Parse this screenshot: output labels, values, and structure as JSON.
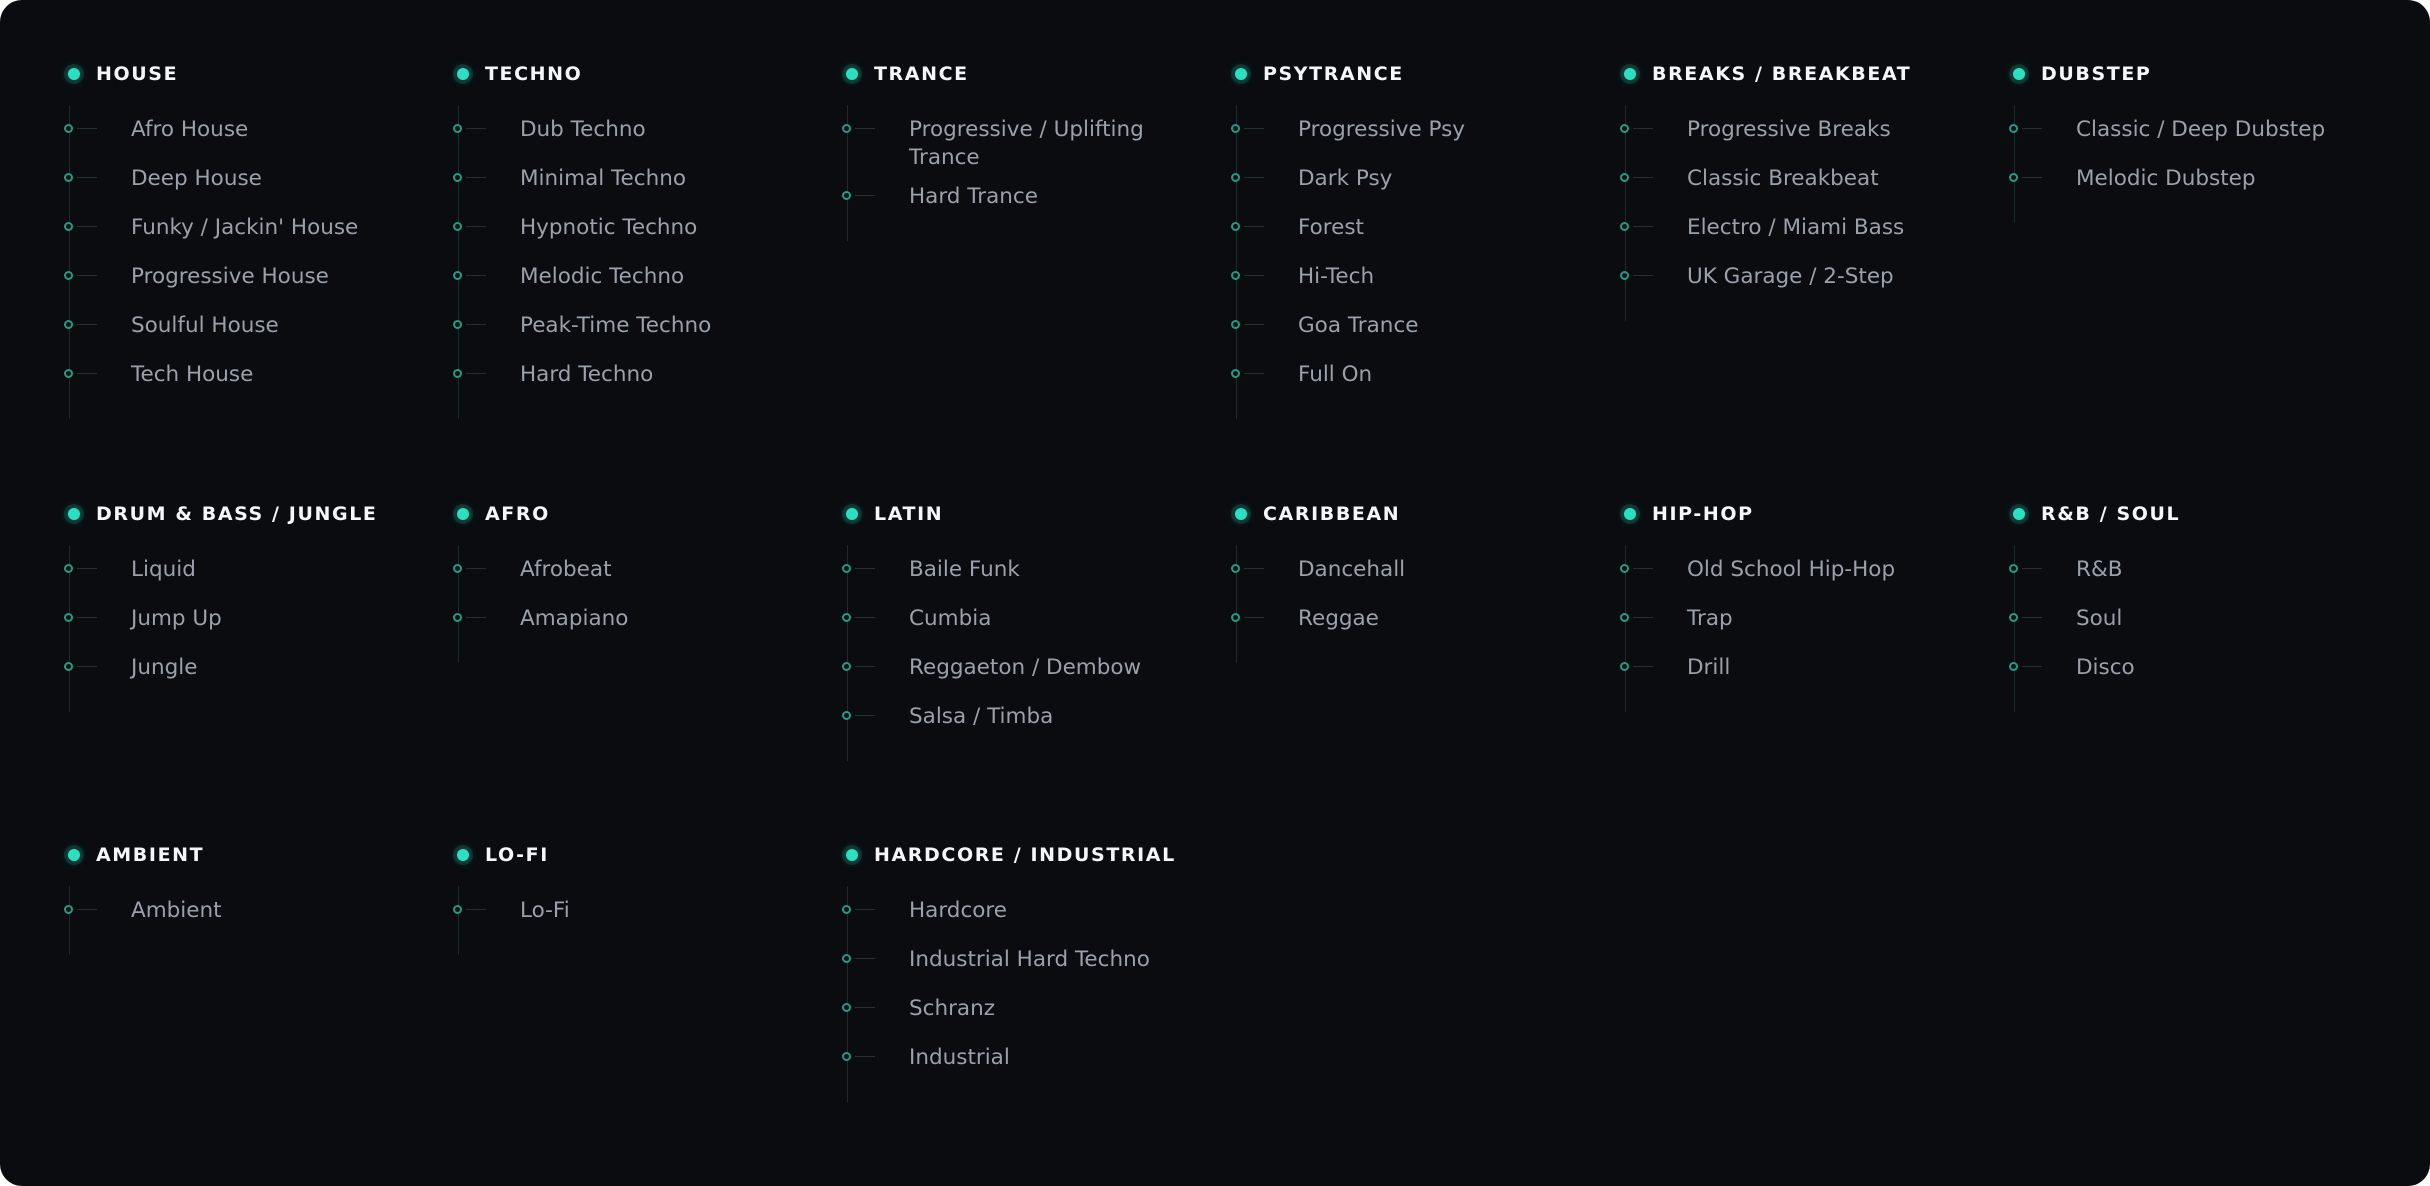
{
  "groups": [
    {
      "title": "HOUSE",
      "items": [
        "Afro House",
        "Deep House",
        "Funky / Jackin' House",
        "Progressive House",
        "Soulful House",
        "Tech House"
      ]
    },
    {
      "title": "TECHNO",
      "items": [
        "Dub Techno",
        "Minimal Techno",
        "Hypnotic Techno",
        "Melodic Techno",
        "Peak-Time Techno",
        "Hard Techno"
      ]
    },
    {
      "title": "TRANCE",
      "items": [
        "Progressive / Uplifting Trance",
        "Hard Trance"
      ]
    },
    {
      "title": "PSYTRANCE",
      "items": [
        "Progressive Psy",
        "Dark Psy",
        "Forest",
        "Hi-Tech",
        "Goa Trance",
        "Full On"
      ]
    },
    {
      "title": "BREAKS / BREAKBEAT",
      "items": [
        "Progressive Breaks",
        "Classic Breakbeat",
        "Electro / Miami Bass",
        "UK Garage / 2-Step"
      ]
    },
    {
      "title": "DUBSTEP",
      "items": [
        "Classic / Deep Dubstep",
        "Melodic Dubstep"
      ]
    },
    {
      "title": "DRUM & BASS / JUNGLE",
      "items": [
        "Liquid",
        "Jump Up",
        "Jungle"
      ]
    },
    {
      "title": "AFRO",
      "items": [
        "Afrobeat",
        "Amapiano"
      ]
    },
    {
      "title": "LATIN",
      "items": [
        "Baile Funk",
        "Cumbia",
        "Reggaeton / Dembow",
        "Salsa / Timba"
      ]
    },
    {
      "title": "CARIBBEAN",
      "items": [
        "Dancehall",
        "Reggae"
      ]
    },
    {
      "title": "HIP-HOP",
      "items": [
        "Old School Hip-Hop",
        "Trap",
        "Drill"
      ]
    },
    {
      "title": "R&B / SOUL",
      "items": [
        "R&B",
        "Soul",
        "Disco"
      ]
    },
    {
      "title": "AMBIENT",
      "items": [
        "Ambient"
      ]
    },
    {
      "title": "LO-FI",
      "items": [
        "Lo-Fi"
      ]
    },
    {
      "title": "HARDCORE / INDUSTRIAL",
      "items": [
        "Hardcore",
        "Industrial Hard Techno",
        "Schranz",
        "Industrial"
      ]
    }
  ],
  "colors": {
    "background": "#0a0c10",
    "accent": "#2be0c0",
    "accent_ring": "#1f9d86",
    "title_text": "#f4f6f8",
    "item_text": "#9aa1aa",
    "line": "#1f2a2c"
  },
  "icons": {
    "group_marker": "filled-dot-icon",
    "item_marker": "ring-icon"
  }
}
